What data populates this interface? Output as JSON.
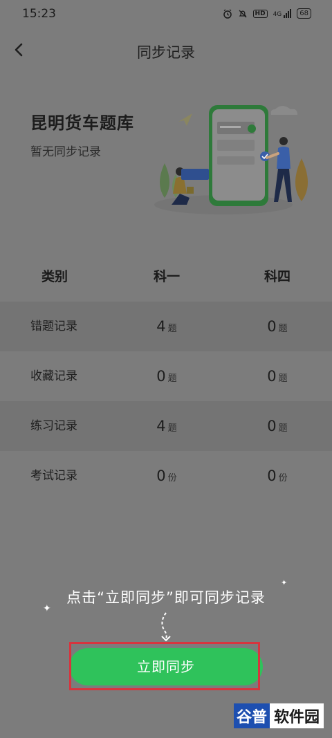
{
  "status_bar": {
    "time": "15:23",
    "hd": "HD",
    "signal": "4G",
    "battery": "68"
  },
  "nav": {
    "title": "同步记录"
  },
  "header": {
    "bank_name": "昆明货车题库",
    "sync_status": "暂无同步记录"
  },
  "table": {
    "headers": [
      "类别",
      "科一",
      "科四"
    ],
    "rows": [
      {
        "label": "错题记录",
        "k1": "4",
        "k1_unit": "题",
        "k4": "0",
        "k4_unit": "题"
      },
      {
        "label": "收藏记录",
        "k1": "0",
        "k1_unit": "题",
        "k4": "0",
        "k4_unit": "题"
      },
      {
        "label": "练习记录",
        "k1": "4",
        "k1_unit": "题",
        "k4": "0",
        "k4_unit": "题"
      },
      {
        "label": "考试记录",
        "k1": "0",
        "k1_unit": "份",
        "k4": "0",
        "k4_unit": "份"
      }
    ]
  },
  "hint": "点击“立即同步”即可同步记录",
  "sync_button": "立即同步",
  "watermark": {
    "part1": "谷普",
    "part2": "软件园"
  },
  "colors": {
    "accent": "#2fc25b",
    "highlight": "#d8343e",
    "overlay": "#7c7c7c"
  }
}
